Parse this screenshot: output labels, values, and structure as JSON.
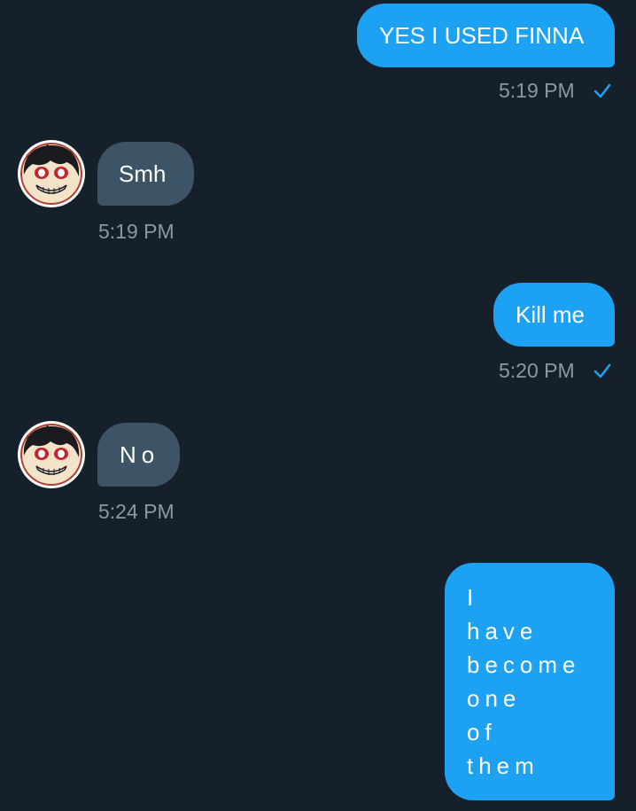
{
  "theme": {
    "background": "#15202b",
    "sent_bubble": "#1da1f2",
    "received_bubble": "#3d5466",
    "timestamp": "#8899a6",
    "read_check": "#1da1f2"
  },
  "messages": [
    {
      "direction": "sent",
      "text": "YES I USED FINNA",
      "time": "5:19 PM",
      "status_icon": "read-check-icon"
    },
    {
      "direction": "received",
      "avatar_icon": "user-avatar-icon",
      "text": "Smh",
      "time": "5:19 PM"
    },
    {
      "direction": "sent",
      "text": "Kill me",
      "time": "5:20 PM",
      "status_icon": "read-check-icon"
    },
    {
      "direction": "received",
      "avatar_icon": "user-avatar-icon",
      "text": "No",
      "time": "5:24 PM"
    },
    {
      "direction": "sent",
      "lines": [
        "I",
        "have",
        "become",
        "one",
        "of",
        "them"
      ]
    }
  ]
}
